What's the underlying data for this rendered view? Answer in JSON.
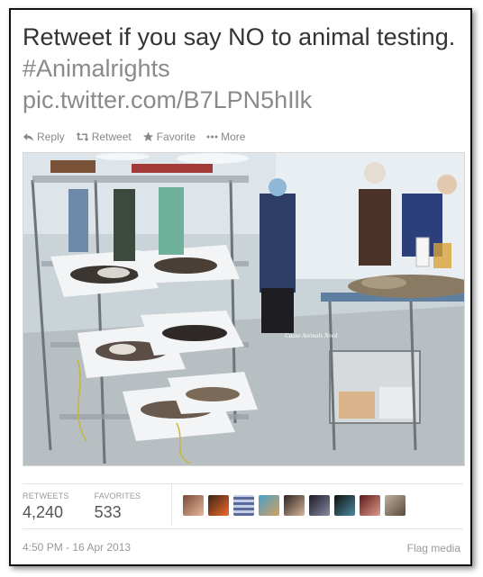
{
  "tweet": {
    "text": "Retweet if you say NO to animal testing.",
    "hashtag": "#Animalrights",
    "link": "pic.twitter.com/B7LPN5hIlk"
  },
  "actions": {
    "reply": "Reply",
    "retweet": "Retweet",
    "favorite": "Favorite",
    "more": "More"
  },
  "photo": {
    "watermark": "Cause Animals Need"
  },
  "stats": {
    "retweets_label": "RETWEETS",
    "retweets_count": "4,240",
    "favorites_label": "FAVORITES",
    "favorites_count": "533"
  },
  "avatars": [
    "avatar-1",
    "avatar-2",
    "avatar-3",
    "avatar-4",
    "avatar-5",
    "avatar-6",
    "avatar-7",
    "avatar-8",
    "avatar-9"
  ],
  "footer": {
    "timestamp": "4:50 PM - 16 Apr 2013",
    "flag": "Flag media"
  },
  "colors": {
    "text": "#333333",
    "muted": "#999999",
    "border": "#111111"
  }
}
